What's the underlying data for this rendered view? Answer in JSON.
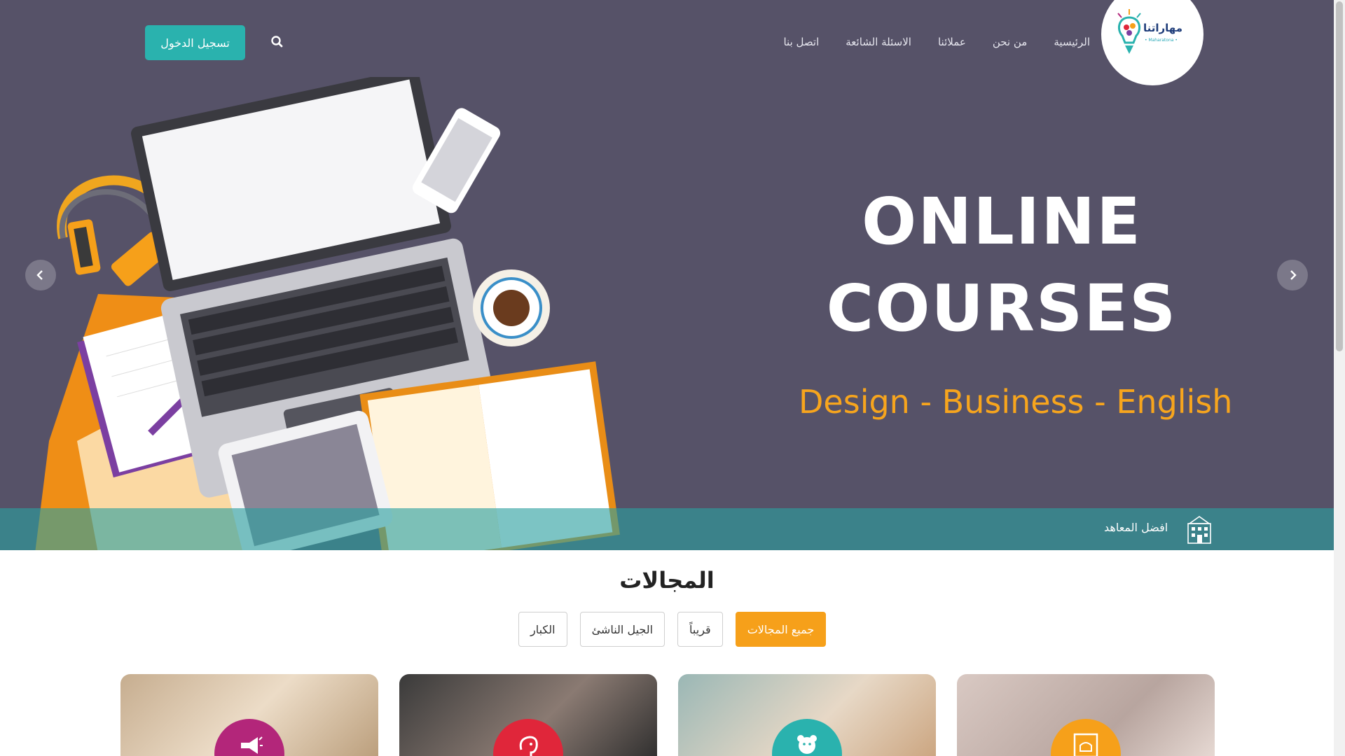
{
  "header": {
    "logo_text": "مهاراتنا",
    "logo_sub": "• Maharatona •",
    "nav": [
      {
        "label": "الرئيسية"
      },
      {
        "label": "من نحن"
      },
      {
        "label": "عملائنا"
      },
      {
        "label": "الاسئلة الشائعة"
      },
      {
        "label": "اتصل بنا"
      }
    ],
    "search_icon": "search-icon",
    "login_label": "تسجيل الدخول"
  },
  "hero": {
    "line1": "ONLINE",
    "line2": "COURSES",
    "subtitle": "Design - Business - English",
    "background": "#565268",
    "accent": "#f7a51d"
  },
  "strip": {
    "label": "افضل المعاهد",
    "icon": "building-icon"
  },
  "categories": {
    "title": "المجالات",
    "filters": [
      {
        "label": "جميع المجالات",
        "active": true
      },
      {
        "label": "قريباً",
        "active": false
      },
      {
        "label": "الجيل الناشئ",
        "active": false
      },
      {
        "label": "الكبار",
        "active": false
      }
    ],
    "cards": [
      {
        "icon": "framed-cake-icon",
        "circle_color": "#f6a01a"
      },
      {
        "icon": "teddy-bear-icon",
        "circle_color": "#2ab2ae"
      },
      {
        "icon": "elephant-icon",
        "circle_color": "#e0263a"
      },
      {
        "icon": "megaphone-icon",
        "circle_color": "#b3267a"
      }
    ]
  },
  "colors": {
    "primary": "#2ab2ae",
    "orange": "#f6a01a"
  }
}
